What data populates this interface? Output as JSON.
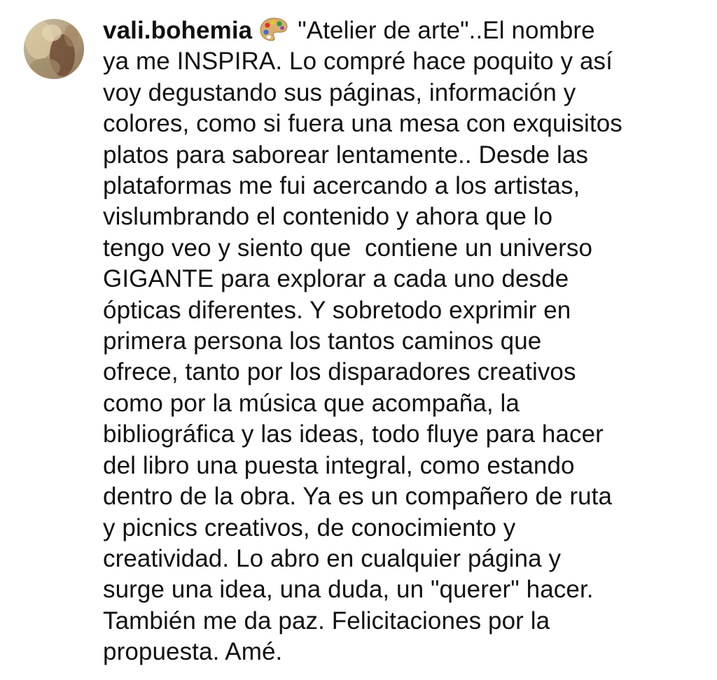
{
  "comment": {
    "username": "vali.bohemia",
    "emoji": "palette-icon",
    "text_lines": [
      "\"Atelier de arte\"..El nombre",
      "ya me INSPIRA. Lo compré hace poquito y así",
      "voy degustando sus páginas, información y",
      "colores, como si fuera una mesa con exquisitos",
      "platos para saborear lentamente.. Desde las",
      "plataformas me fui acercando a los artistas,",
      "vislumbrando el contenido y ahora que lo",
      "tengo veo y siento que  contiene un universo",
      "GIGANTE para explorar a cada uno desde",
      "ópticas diferentes. Y sobretodo exprimir en",
      "primera persona los tantos caminos que",
      "ofrece, tanto por los disparadores creativos",
      "como por la música que acompaña, la",
      "bibliográfica y las ideas, todo fluye para hacer",
      "del libro una puesta integral, como estando",
      "dentro de la obra. Ya es un compañero de ruta",
      "y picnics creativos, de conocimiento y",
      "creatividad. Lo abro en cualquier página y",
      "surge una idea, una duda, un \"querer\" hacer.",
      "También me da paz. Felicitaciones por la",
      "propuesta. Amé."
    ]
  },
  "colors": {
    "text": "#111111",
    "background": "#ffffff"
  }
}
